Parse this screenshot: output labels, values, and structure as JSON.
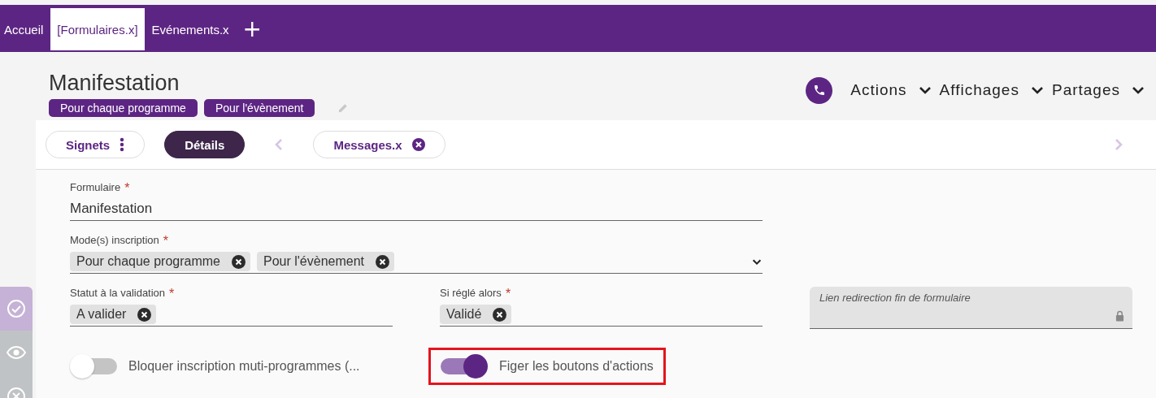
{
  "top_tabs": [
    {
      "label": "Accueil",
      "selected": false
    },
    {
      "label": "[Formulaires.x]",
      "selected": true
    },
    {
      "label": "Evénements.x",
      "selected": false
    }
  ],
  "add_tab": "+",
  "header": {
    "title": "Manifestation",
    "tags": [
      "Pour chaque programme",
      "Pour l'évènement"
    ]
  },
  "menus": [
    "Actions",
    "Affichages",
    "Partages"
  ],
  "sub_tabs": [
    {
      "label": "Signets",
      "selected": false,
      "kind": "menu"
    },
    {
      "label": "Détails",
      "selected": true,
      "kind": "plain"
    },
    {
      "label": "Messages.x",
      "selected": false,
      "kind": "closable"
    }
  ],
  "sidebar": [
    {
      "kind": "check",
      "selected": true
    },
    {
      "kind": "eye",
      "selected": false
    },
    {
      "kind": "close",
      "selected": false
    }
  ],
  "rows": [
    [
      {
        "kind": "text",
        "label": "Formulaire",
        "required_mark": "*",
        "value": "Manifestation"
      }
    ],
    [
      {
        "kind": "chips",
        "label": "Mode(s) inscription",
        "required_mark": "*",
        "chips": [
          "Pour chaque programme",
          "Pour l'évènement"
        ],
        "dropdown": true
      }
    ],
    [
      {
        "kind": "chips",
        "label": "Statut à la validation",
        "required_mark": "*",
        "chips": [
          "A valider"
        ],
        "dropdown": false
      },
      {
        "kind": "chips",
        "label": "Si réglé alors",
        "required_mark": "*",
        "chips": [
          "Validé"
        ],
        "dropdown": false
      },
      {
        "kind": "locked",
        "placeholder": "Lien redirection fin de formulaire"
      }
    ]
  ],
  "toggles": [
    {
      "label": "Bloquer inscription muti-programmes (...",
      "on": false,
      "highlighted": false
    },
    {
      "label": "Figer les boutons d'actions",
      "on": true,
      "highlighted": true
    }
  ]
}
